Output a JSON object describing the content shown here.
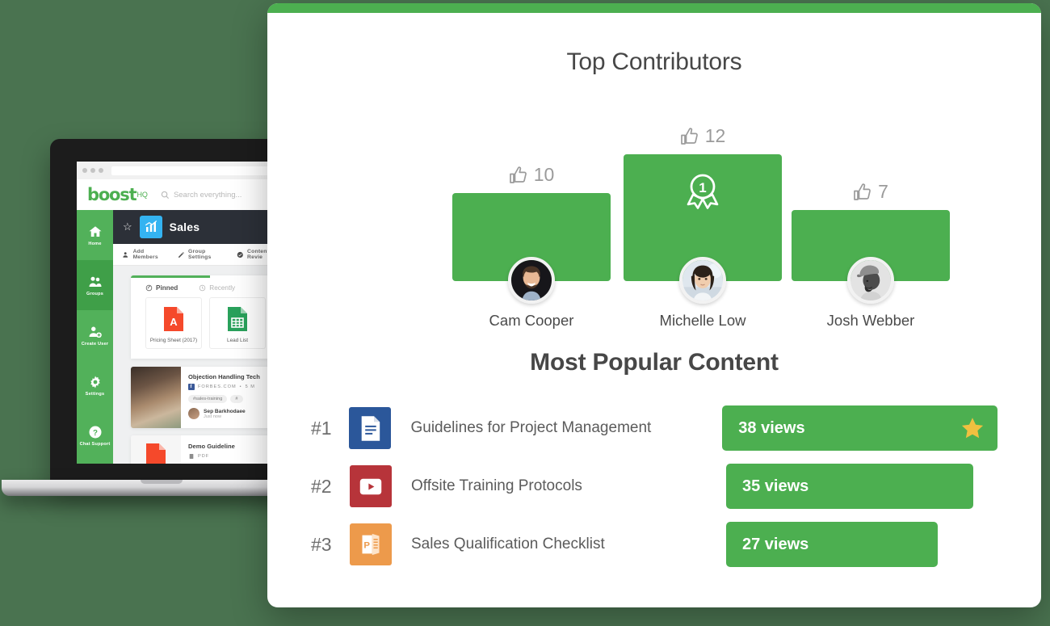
{
  "background_color": "#4a7350",
  "accent_green": "#4CAF50",
  "star_color": "#F0C040",
  "laptop": {
    "browser": {
      "omnibox_value": ""
    },
    "app": {
      "logo": "boost",
      "logo_suffix": "HQ",
      "search_placeholder": "Search everything...",
      "sidebar": [
        {
          "label": "Home",
          "icon": "home-icon",
          "selected": false
        },
        {
          "label": "Groups",
          "icon": "groups-icon",
          "selected": true
        },
        {
          "label": "Create User",
          "icon": "create-user-icon",
          "selected": false
        },
        {
          "label": "Settings",
          "icon": "gear-icon",
          "selected": false
        },
        {
          "label": "Chat Support",
          "icon": "help-icon",
          "selected": false
        }
      ],
      "group": {
        "title": "Sales",
        "actions": [
          {
            "label": "Add Members",
            "icon": "add-members-icon"
          },
          {
            "label": "Group Settings",
            "icon": "pencil-icon"
          },
          {
            "label": "Content Revie",
            "icon": "verified-icon"
          }
        ]
      },
      "panel": {
        "tabs": [
          {
            "label": "Pinned",
            "icon": "pin-icon",
            "active": true
          },
          {
            "label": "Recently",
            "icon": "clock-icon",
            "active": false
          }
        ],
        "files": [
          {
            "name": "Pricing Sheet (2017)",
            "icon": "pdf-icon"
          },
          {
            "name": "Lead List",
            "icon": "spreadsheet-icon"
          }
        ]
      },
      "post": {
        "title": "Objection Handling Tech",
        "source": "FORBES.COM",
        "read_time": "5 M",
        "tags": [
          "#sales-training",
          "#"
        ],
        "author": "Sep Barkhodaee",
        "time": "Just now"
      },
      "post2": {
        "title": "Demo Guideline",
        "meta": "PDF",
        "icon": "pdf-icon"
      }
    }
  },
  "card": {
    "contributors_title": "Top Contributors",
    "contributors": [
      {
        "name": "Cam Cooper",
        "likes": "10",
        "rank": 2,
        "winner": false
      },
      {
        "name": "Michelle Low",
        "likes": "12",
        "rank": 1,
        "winner": true,
        "badge": "1"
      },
      {
        "name": "Josh Webber",
        "likes": "7",
        "rank": 3,
        "winner": false
      }
    ],
    "popular_title": "Most Popular Content",
    "popular": [
      {
        "rank": "#1",
        "name": "Guidelines for Project Management",
        "views": "38 views",
        "icon": "word-document-icon",
        "icon_color": "#2B579A",
        "starred": true
      },
      {
        "rank": "#2",
        "name": "Offsite Training Protocols",
        "views": "35 views",
        "icon": "youtube-video-icon",
        "icon_color": "#B7343A",
        "starred": false
      },
      {
        "rank": "#3",
        "name": "Sales Qualification Checklist",
        "views": "27 views",
        "icon": "powerpoint-icon",
        "icon_color": "#ED9A4B",
        "starred": false
      }
    ]
  },
  "chart_data": {
    "type": "bar",
    "title": "Top Contributors",
    "categories": [
      "Cam Cooper",
      "Michelle Low",
      "Josh Webber"
    ],
    "values": [
      10,
      12,
      7
    ],
    "ylabel": "Likes",
    "charts": [
      {
        "type": "bar",
        "title": "Most Popular Content",
        "categories": [
          "Guidelines for Project Management",
          "Offsite Training Protocols",
          "Sales Qualification Checklist"
        ],
        "values": [
          38,
          35,
          27
        ],
        "xlabel": "views"
      }
    ]
  }
}
